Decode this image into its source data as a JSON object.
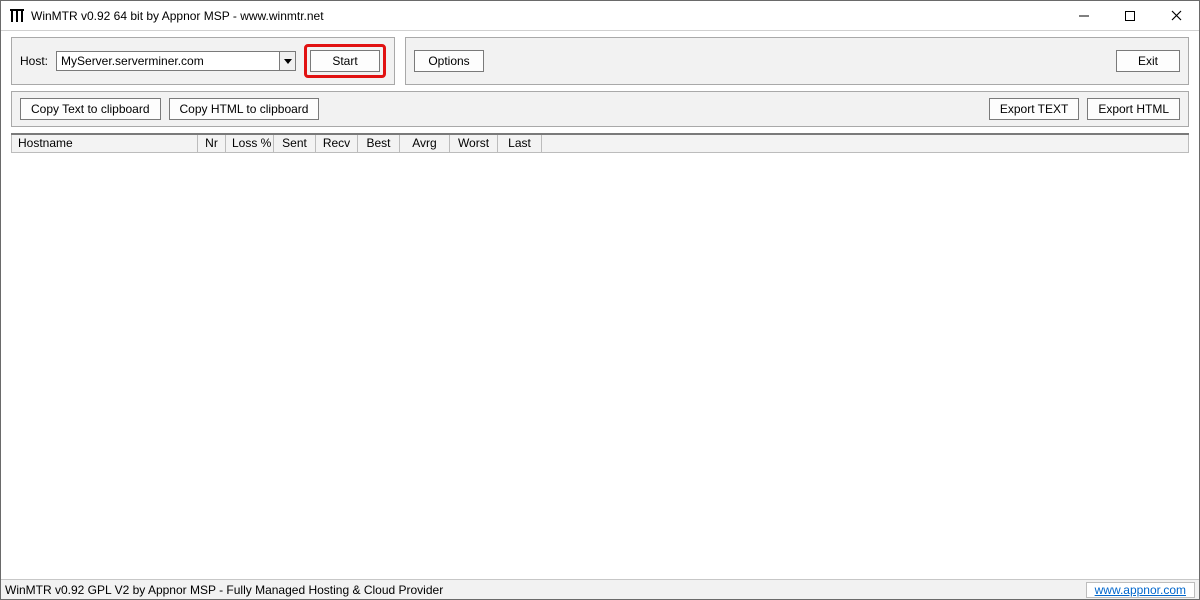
{
  "title": "WinMTR v0.92 64 bit by Appnor MSP - www.winmtr.net",
  "host": {
    "label": "Host:",
    "value": "MyServer.serverminer.com"
  },
  "buttons": {
    "start": "Start",
    "options": "Options",
    "exit": "Exit",
    "copy_text": "Copy Text to clipboard",
    "copy_html": "Copy HTML to clipboard",
    "export_text": "Export TEXT",
    "export_html": "Export HTML"
  },
  "columns": {
    "hostname": "Hostname",
    "nr": "Nr",
    "loss": "Loss %",
    "sent": "Sent",
    "recv": "Recv",
    "best": "Best",
    "avrg": "Avrg",
    "worst": "Worst",
    "last": "Last"
  },
  "status": {
    "text": "WinMTR v0.92 GPL V2 by Appnor MSP - Fully Managed Hosting & Cloud Provider",
    "link": "www.appnor.com"
  }
}
